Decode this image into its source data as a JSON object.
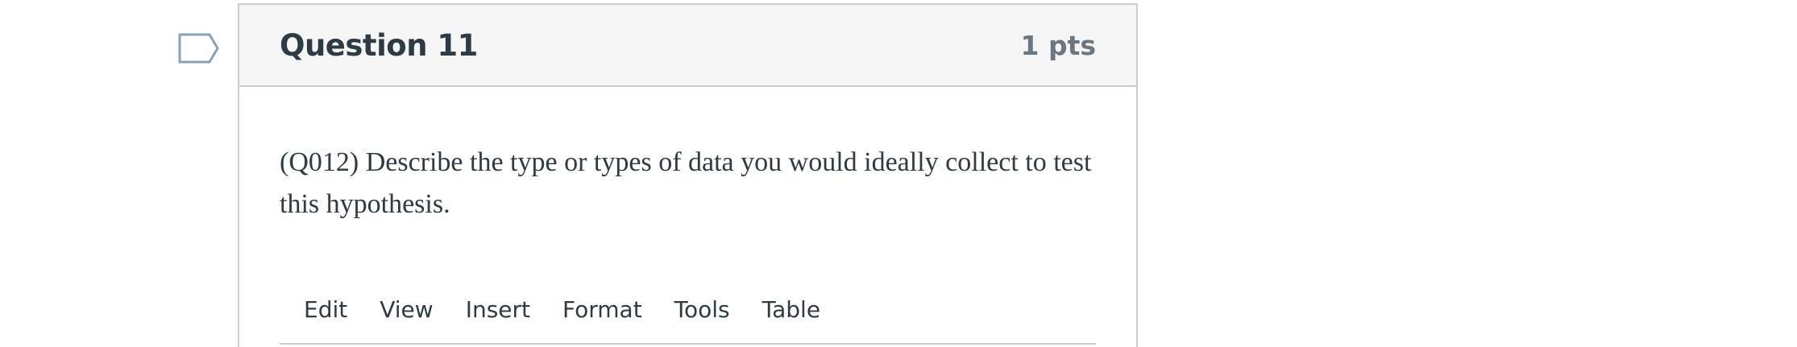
{
  "question": {
    "title": "Question 11",
    "points": "1 pts",
    "text": "(Q012) Describe the type or types of data you would ideally collect to test this hypothesis."
  },
  "editor": {
    "menubar": [
      {
        "label": "Edit"
      },
      {
        "label": "View"
      },
      {
        "label": "Insert"
      },
      {
        "label": "Format"
      },
      {
        "label": "Tools"
      },
      {
        "label": "Table"
      }
    ]
  },
  "colors": {
    "header_bg": "#f5f5f5",
    "border": "#c7cdd1",
    "text": "#2d3b45",
    "points_text": "#6b7780",
    "flag_stroke": "#8aa0b5"
  },
  "icons": {
    "flag": "flag-question-icon"
  }
}
